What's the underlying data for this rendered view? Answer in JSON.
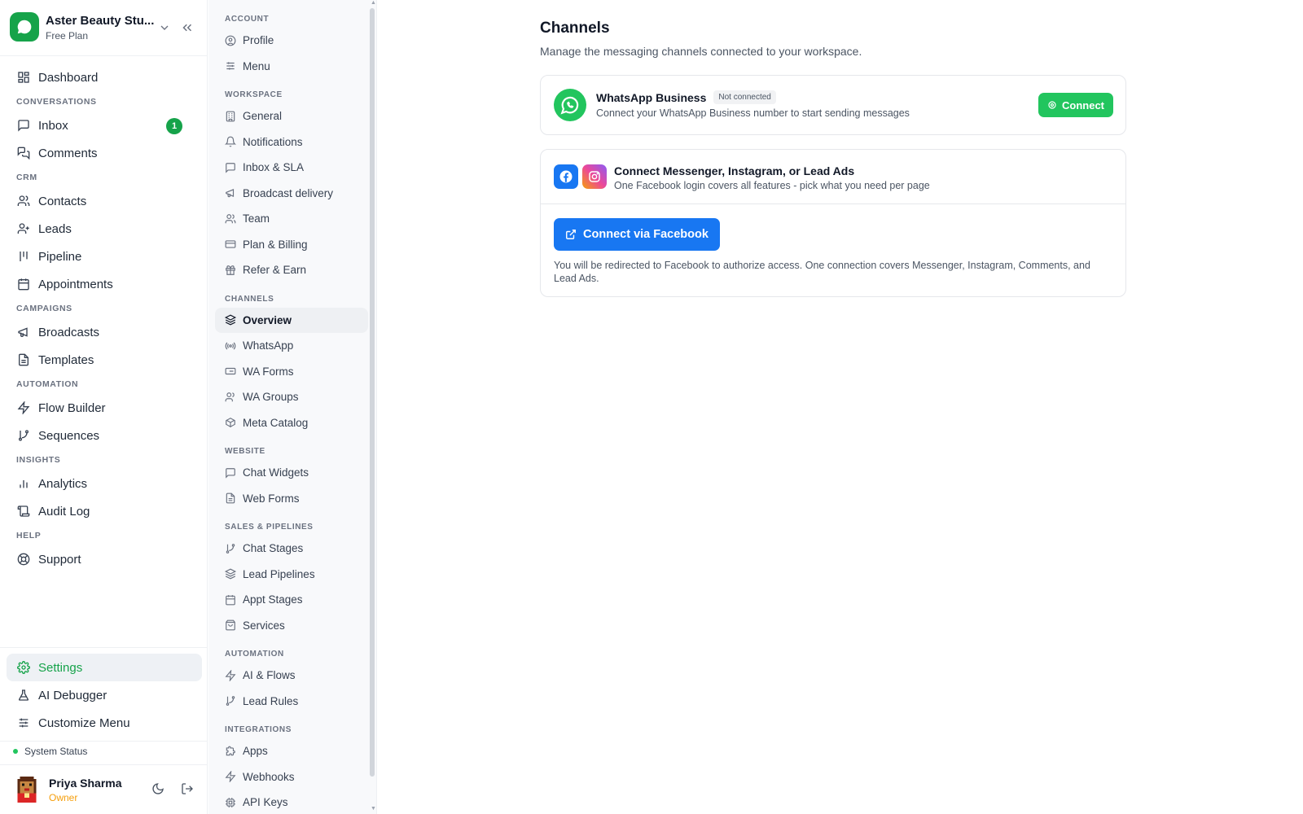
{
  "brand": {
    "name": "Aster Beauty Stu...",
    "plan": "Free Plan"
  },
  "nav": {
    "dashboard": "Dashboard",
    "sections": {
      "conversations": "CONVERSATIONS",
      "crm": "CRM",
      "campaigns": "CAMPAIGNS",
      "automation": "AUTOMATION",
      "insights": "INSIGHTS",
      "help": "HELP"
    },
    "inbox": "Inbox",
    "inbox_badge": "1",
    "comments": "Comments",
    "contacts": "Contacts",
    "leads": "Leads",
    "pipeline": "Pipeline",
    "appointments": "Appointments",
    "broadcasts": "Broadcasts",
    "templates": "Templates",
    "flow_builder": "Flow Builder",
    "sequences": "Sequences",
    "analytics": "Analytics",
    "audit_log": "Audit Log",
    "support": "Support",
    "settings": "Settings",
    "ai_debugger": "AI Debugger",
    "customize_menu": "Customize Menu"
  },
  "system_status": "System Status",
  "user": {
    "name": "Priya Sharma",
    "role": "Owner"
  },
  "settings_nav": {
    "account": "ACCOUNT",
    "profile": "Profile",
    "menu": "Menu",
    "workspace": "WORKSPACE",
    "general": "General",
    "notifications": "Notifications",
    "inbox_sla": "Inbox & SLA",
    "broadcast_delivery": "Broadcast delivery",
    "team": "Team",
    "plan_billing": "Plan & Billing",
    "refer_earn": "Refer & Earn",
    "channels": "CHANNELS",
    "overview": "Overview",
    "whatsapp": "WhatsApp",
    "wa_forms": "WA Forms",
    "wa_groups": "WA Groups",
    "meta_catalog": "Meta Catalog",
    "website": "WEBSITE",
    "chat_widgets": "Chat Widgets",
    "web_forms": "Web Forms",
    "sales": "SALES & PIPELINES",
    "chat_stages": "Chat Stages",
    "lead_pipelines": "Lead Pipelines",
    "appt_stages": "Appt Stages",
    "services": "Services",
    "automation": "AUTOMATION",
    "ai_flows": "AI & Flows",
    "lead_rules": "Lead Rules",
    "integrations": "INTEGRATIONS",
    "apps": "Apps",
    "webhooks": "Webhooks",
    "api_keys": "API Keys"
  },
  "main": {
    "title": "Channels",
    "subtitle": "Manage the messaging channels connected to your workspace.",
    "whatsapp": {
      "title": "WhatsApp Business",
      "status": "Not connected",
      "desc": "Connect your WhatsApp Business number to start sending messages",
      "button": "Connect"
    },
    "meta": {
      "title": "Connect Messenger, Instagram, or Lead Ads",
      "desc": "One Facebook login covers all features - pick what you need per page",
      "button": "Connect via Facebook",
      "note": "You will be redirected to Facebook to authorize access. One connection covers Messenger, Instagram, Comments, and Lead Ads."
    }
  },
  "colors": {
    "accent": "#16a34a",
    "whatsapp": "#22c55e",
    "facebook": "#1877f2",
    "owner": "#f59e0b"
  }
}
